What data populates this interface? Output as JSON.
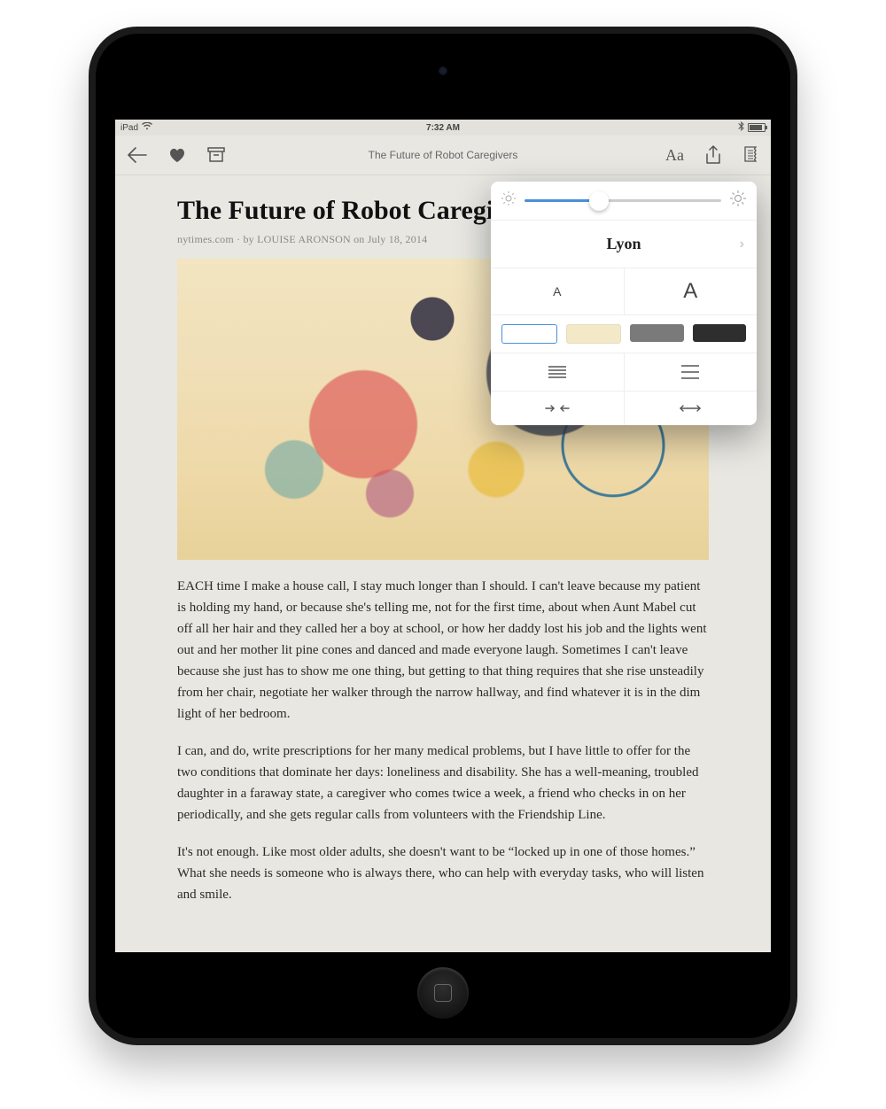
{
  "status": {
    "device": "iPad",
    "time": "7:32 AM"
  },
  "toolbar": {
    "title": "The Future of Robot Caregivers",
    "font_label": "Aa"
  },
  "article": {
    "title": "The Future of Robot Caregivers",
    "source": "nytimes.com",
    "byline_sep1": " · by ",
    "author": "LOUISE ARONSON",
    "byline_sep2": " on ",
    "date": "July 18, 2014",
    "paragraphs": [
      "EACH time I make a house call, I stay much longer than I should. I can't leave because my patient is holding my hand, or because she's telling me, not for the first time, about when Aunt Mabel cut off all her hair and they called her a boy at school, or how her daddy lost his job and the lights went out and her mother lit pine cones and danced and made everyone laugh. Sometimes I can't leave because she just has to show me one thing, but getting to that thing requires that she rise unsteadily from her chair, negotiate her walker through the narrow hallway, and find whatever it is in the dim light of her bedroom.",
      "I can, and do, write prescriptions for her many medical problems, but I have little to offer for the two conditions that dominate her days: loneliness and disability. She has a well-meaning, troubled daughter in a faraway state, a caregiver who comes twice a week, a friend who checks in on her periodically, and she gets regular calls from volunteers with the Friendship Line.",
      "It's not enough. Like most older adults, she doesn't want to be “locked up in one of those homes.” What she needs is someone who is always there, who can help with everyday tasks, who will listen and smile."
    ]
  },
  "popover": {
    "font_name": "Lyon",
    "size_small": "A",
    "size_large": "A",
    "themes": {
      "white": "#ffffff",
      "sepia": "#f3e8c8",
      "gray": "#7a7a7a",
      "black": "#2e2e2e"
    }
  }
}
